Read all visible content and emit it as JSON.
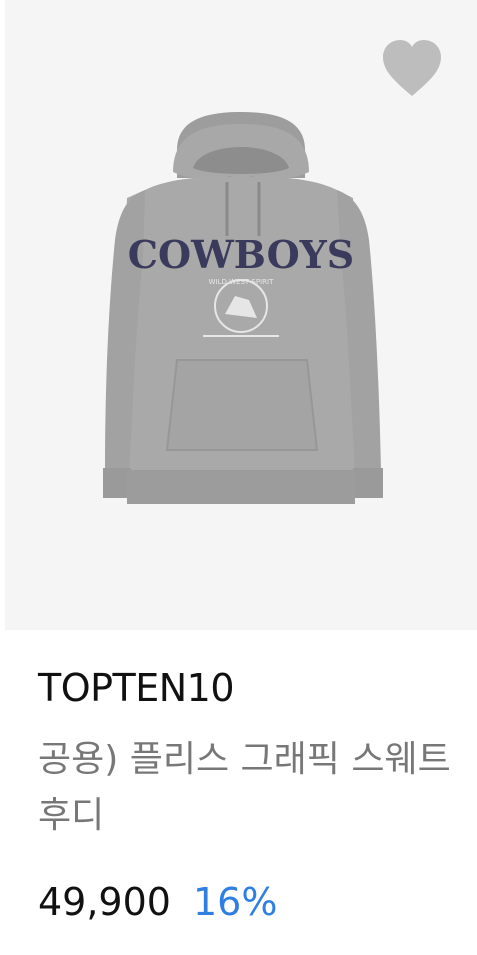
{
  "product": {
    "brand": "TOPTEN10",
    "name": "공용) 플리스 그래픽 스웨트후디",
    "price": "49,900",
    "discount": "16%"
  },
  "image": {
    "graphic_title": "COWBOYS",
    "graphic_subtitle": "WILD WEST SPIRIT",
    "background_color": "#f5f5f5",
    "hoodie_color": "#a6a6a6",
    "print_color": "#3a3a5c"
  },
  "colors": {
    "discount": "#2f7fe3",
    "heart": "#bdbdbd"
  },
  "icons": {
    "wishlist": "heart-icon"
  }
}
